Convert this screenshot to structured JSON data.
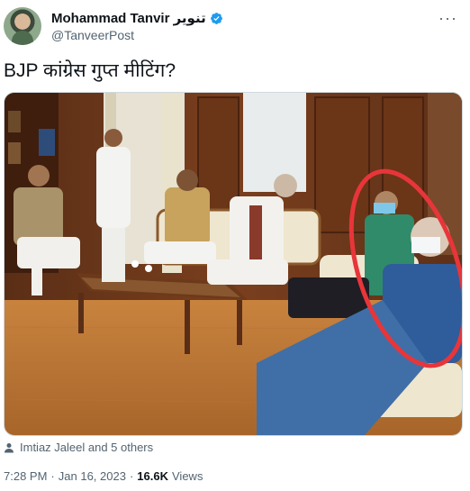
{
  "author": {
    "name": "Mohammad Tanvir تنویر",
    "handle": "@TanveerPost",
    "verified_color": "#1d9bf0"
  },
  "tweet": {
    "text": "BJP कांग्रेस गुप्त मीटिंग?",
    "more_label": "···"
  },
  "media": {
    "description_icon": "photo",
    "highlight_color": "#e8353a"
  },
  "tags": {
    "label": "Imtiaz Jaleel and 5 others",
    "icon": "person-icon"
  },
  "meta": {
    "time": "7:28 PM",
    "date": "Jan 16, 2023",
    "separator": "·",
    "views_count": "16.6K",
    "views_label": "Views"
  }
}
